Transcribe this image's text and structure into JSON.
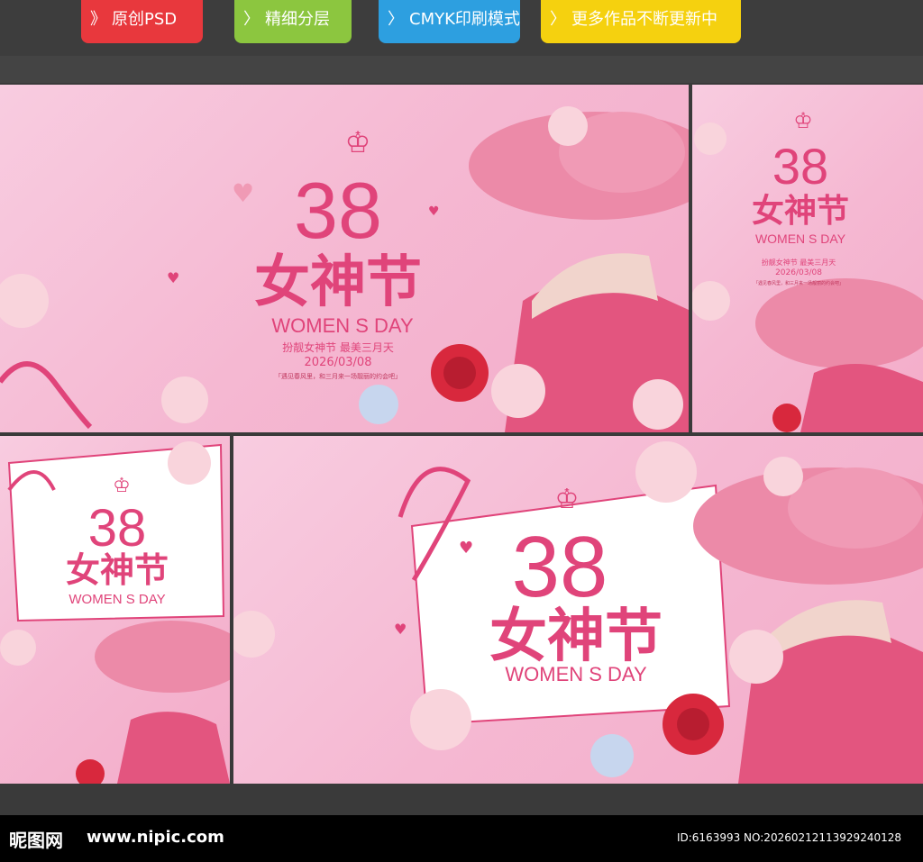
{
  "tags": [
    {
      "label": "原创PSD",
      "color": "#e8383d"
    },
    {
      "label": "精细分层",
      "color": "#8cc63f"
    },
    {
      "label": "CMYK印刷模式",
      "color": "#2d9fe0"
    },
    {
      "label": "更多作品不断更新中",
      "color": "#f5d10f"
    }
  ],
  "poster": {
    "number": "38",
    "title": "女神节",
    "subtitle": "WOMEN S DAY",
    "tagline": "扮靓女神节 最美三月天",
    "date": "2026/03/08",
    "slogan": "「遇见春风里，和三月来一场靓丽的约会吧」"
  },
  "footer": {
    "logo": "昵图网",
    "url": "www.nipic.com",
    "id": "ID:6163993 NO:20260212113929240128"
  },
  "colors": {
    "accent": "#e0447a",
    "bg": "#f6bed6"
  }
}
